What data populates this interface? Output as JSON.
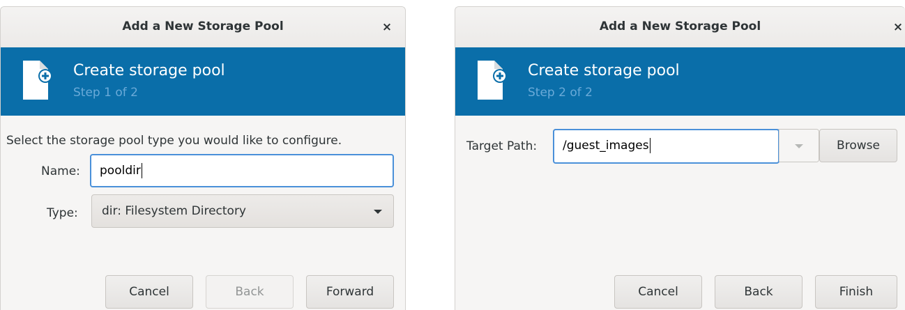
{
  "dialog1": {
    "title": "Add a New Storage Pool",
    "close_glyph": "×",
    "banner": {
      "icon": "document-add-icon",
      "heading": "Create storage pool",
      "step": "Step 1 of 2"
    },
    "instruction": "Select the storage pool type you would like to configure.",
    "name_label": "Name:",
    "name_value": "pooldir",
    "type_label": "Type:",
    "type_value": "dir: Filesystem Directory",
    "buttons": {
      "cancel": "Cancel",
      "back": "Back",
      "forward": "Forward"
    },
    "back_enabled": false
  },
  "dialog2": {
    "title": "Add a New Storage Pool",
    "close_glyph": "×",
    "banner": {
      "icon": "document-add-icon",
      "heading": "Create storage pool",
      "step": "Step 2 of 2"
    },
    "target_label": "Target Path:",
    "target_value": "/guest_images",
    "browse": "Browse",
    "buttons": {
      "cancel": "Cancel",
      "back": "Back",
      "finish": "Finish"
    }
  },
  "colors": {
    "banner": "#0a6ea9",
    "step_text": "#6aaad8",
    "focus": "#4a90d9",
    "dialog_bg": "#f6f5f4"
  }
}
